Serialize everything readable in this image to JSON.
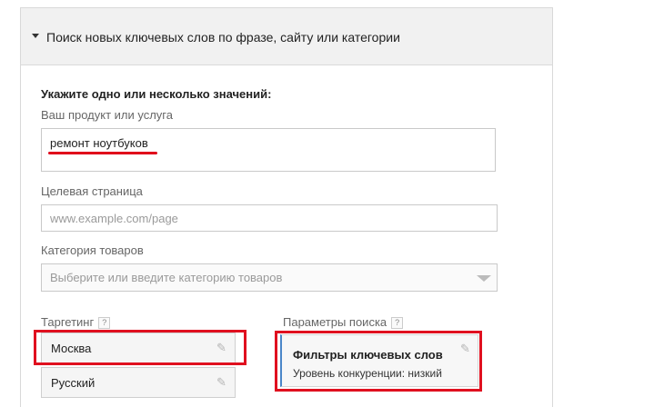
{
  "panel": {
    "title": "Поиск новых ключевых слов по фразе, сайту или категории"
  },
  "form": {
    "section_title": "Укажите одно или несколько значений:",
    "product_label": "Ваш продукт или услуга",
    "product_value": "ремонт ноутбуков",
    "landing_label": "Целевая страница",
    "landing_placeholder": "www.example.com/page",
    "category_label": "Категория товаров",
    "category_placeholder": "Выберите или введите категорию товаров"
  },
  "targeting": {
    "label": "Таргетинг",
    "help": "?",
    "items": [
      {
        "label": "Москва"
      },
      {
        "label": "Русский"
      }
    ]
  },
  "search_params": {
    "label": "Параметры поиска",
    "help": "?",
    "filters_title": "Фильтры ключевых слов",
    "filters_detail": "Уровень конкуренции: низкий"
  },
  "icons": {
    "caret": "caret-down-icon",
    "pencil": "pencil-icon",
    "dropdown": "dropdown-arrow-icon"
  },
  "colors": {
    "highlight": "#e0101f",
    "accent": "#4a86c8"
  }
}
